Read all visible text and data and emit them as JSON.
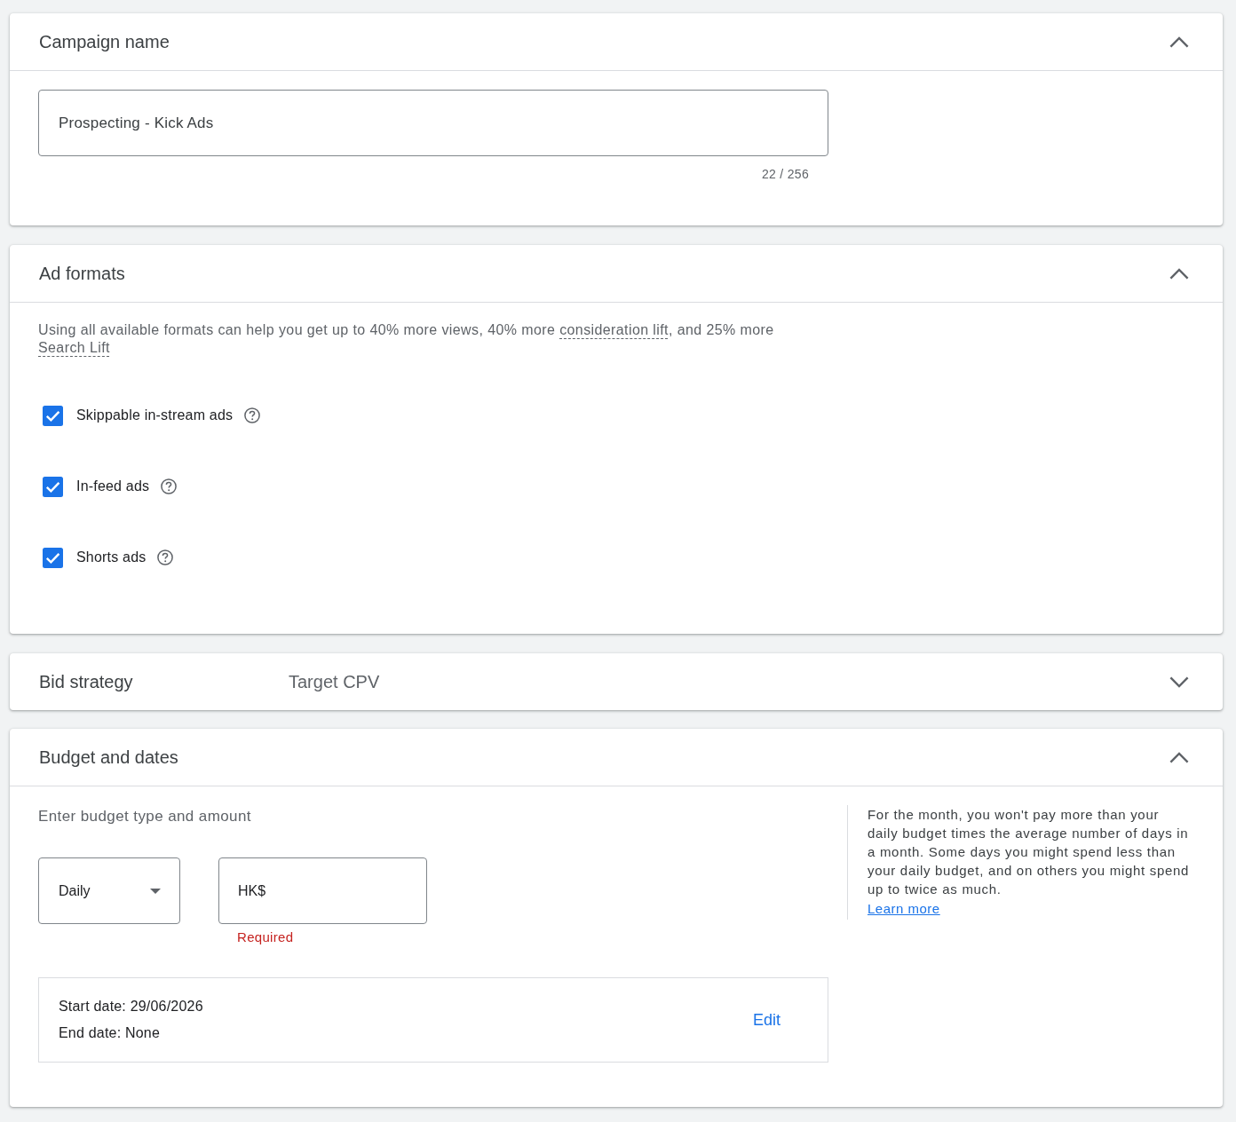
{
  "sections": [
    {
      "kind": "campaign_name",
      "title": "Campaign name",
      "expanded": true,
      "name_field": {
        "value": "Prospecting - Kick Ads",
        "counter": "22 / 256"
      }
    },
    {
      "kind": "ad_formats",
      "title": "Ad formats",
      "expanded": true,
      "description": [
        {
          "kind": "text",
          "text": "Using all available formats can help you get up to 40% more views, 40% more "
        },
        {
          "kind": "term",
          "text": "consideration lift"
        },
        {
          "kind": "text",
          "text": ", and 25% more "
        },
        {
          "kind": "term",
          "text": "Search Lift"
        }
      ],
      "formats": [
        {
          "label": "Skippable in-stream ads",
          "checked": true
        },
        {
          "label": "In-feed ads",
          "checked": true
        },
        {
          "label": "Shorts ads",
          "checked": true
        }
      ]
    },
    {
      "kind": "bid_strategy",
      "title": "Bid strategy",
      "expanded": false,
      "summary": "Target CPV"
    },
    {
      "kind": "budget_and_dates",
      "title": "Budget and dates",
      "expanded": true,
      "prompt": "Enter budget type and amount",
      "budget_type": "Daily",
      "amount": {
        "prefix": "HK$",
        "error": "Required"
      },
      "dates": {
        "start": "Start date: 29/06/2026",
        "end": "End date: None",
        "edit": "Edit"
      },
      "help": {
        "text": "For the month, you won't pay more than your daily budget times the average number of days in a month. Some days you might spend less than your daily budget, and on others you might spend up to twice as much.",
        "link": "Learn more"
      }
    }
  ]
}
